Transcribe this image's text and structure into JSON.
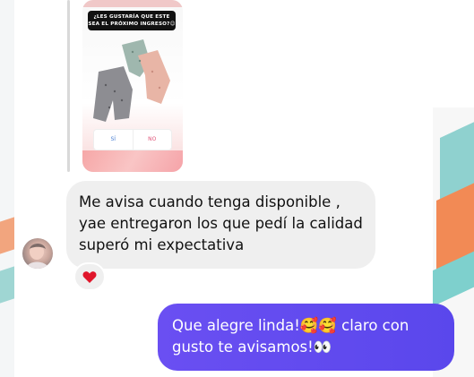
{
  "story": {
    "question_sticker": "¿LES GUSTARÍA QUE ESTE SEA EL PRÓXIMO INGRESO?😊",
    "poll_options": [
      "SÍ",
      "NO"
    ]
  },
  "incoming_message": {
    "lines": [
      "Me avisa cuando tenga disponible ,",
      "yae entregaron los que pedí la calidad",
      "superó mi expectativa"
    ],
    "reaction": "❤️"
  },
  "outgoing_message": {
    "lines": [
      "Que alegre linda!🥰🥰 claro con",
      "gusto te avisamos!👀"
    ]
  },
  "colors": {
    "outgoing_bubble": "#5a47ec",
    "incoming_bubble": "#efefef",
    "reaction_heart": "#e0162b"
  }
}
